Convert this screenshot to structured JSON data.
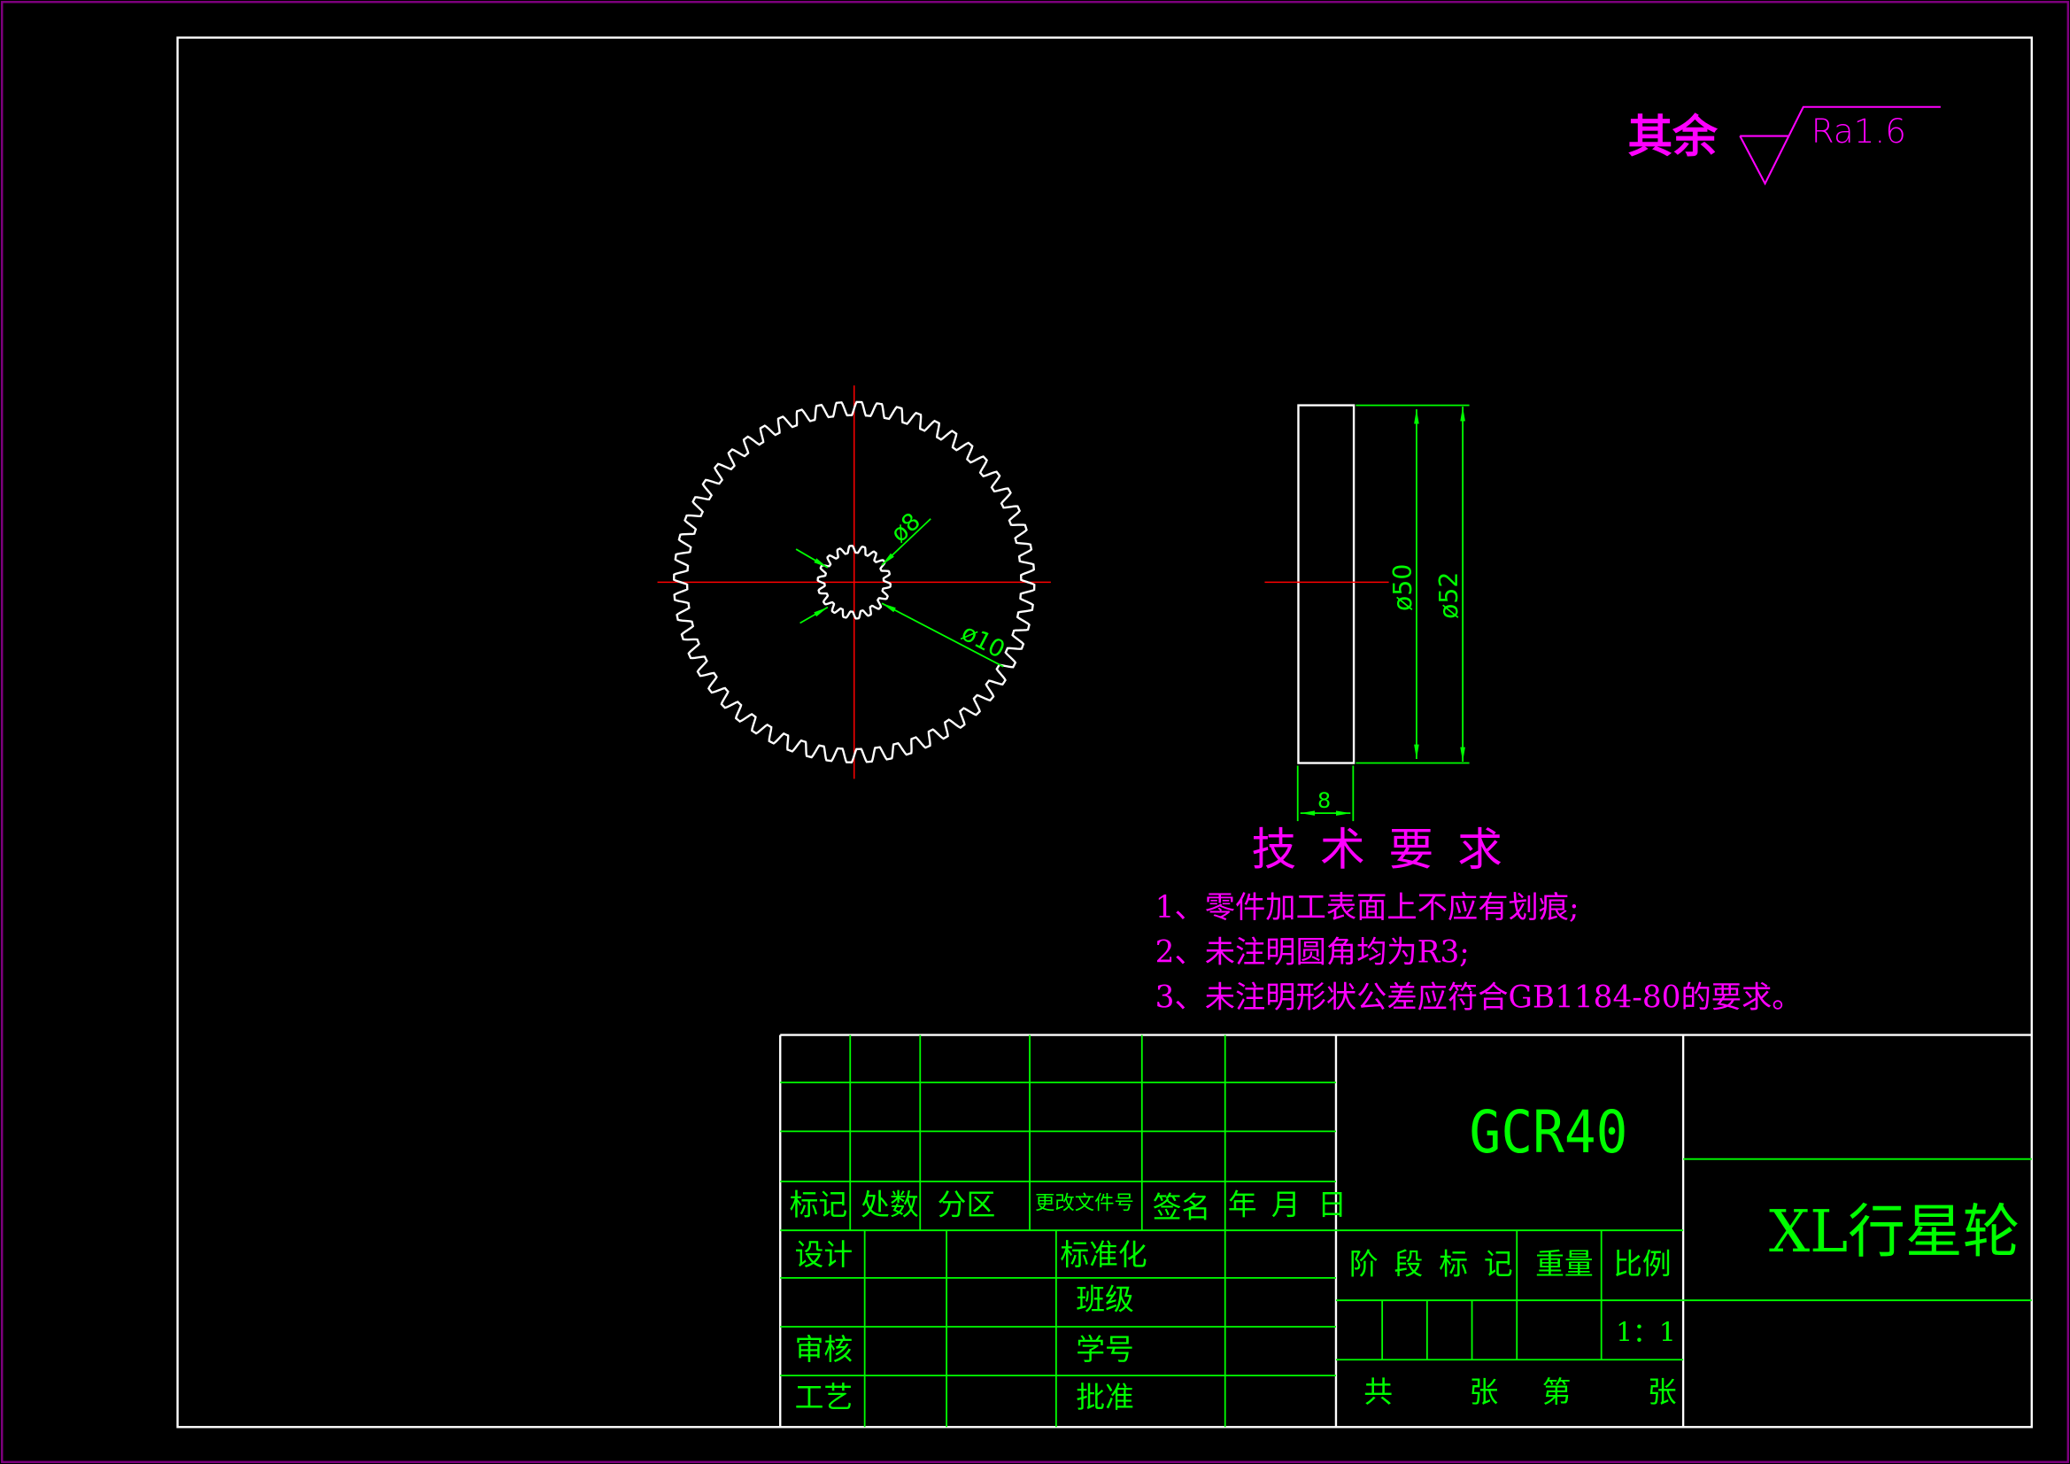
{
  "drawing": {
    "surface_finish": {
      "prefix": "其余",
      "roughness": "Ra1.6"
    },
    "front_view": {
      "dim_bore": "ø8",
      "dim_spline": "ø10"
    },
    "side_view": {
      "dim_root": "ø50",
      "dim_tip": "ø52",
      "dim_width": "8"
    },
    "technical_requirements": {
      "title": "技术要求",
      "items": [
        "1、零件加工表面上不应有划痕;",
        "2、未注明圆角均为R3;",
        "3、未注明形状公差应符合GB1184-80的要求。"
      ]
    }
  },
  "title_block": {
    "material": "GCR40",
    "part_name": "XL行星轮",
    "revision_headers": [
      "标记",
      "处数",
      "分区",
      "更改文件号",
      "签名",
      "年",
      "月",
      "日"
    ],
    "approvals": {
      "design": "设计",
      "standardization": "标准化",
      "class": "班级",
      "review": "审核",
      "student_no": "学号",
      "process": "工艺",
      "approve": "批准"
    },
    "stage_mark": "阶段标记",
    "weight": "重量",
    "scale_label": "比例",
    "scale": "1：1",
    "sheets": {
      "total_prefix": "共",
      "total_suffix": "张",
      "index_prefix": "第",
      "index_suffix": "张"
    }
  },
  "colors": {
    "background": "#000000",
    "outline": "#ffffff",
    "annotation": "#ff00ff",
    "dimension": "#00ff00",
    "center_line": "#ff0000",
    "sheet_border": "#800080"
  }
}
